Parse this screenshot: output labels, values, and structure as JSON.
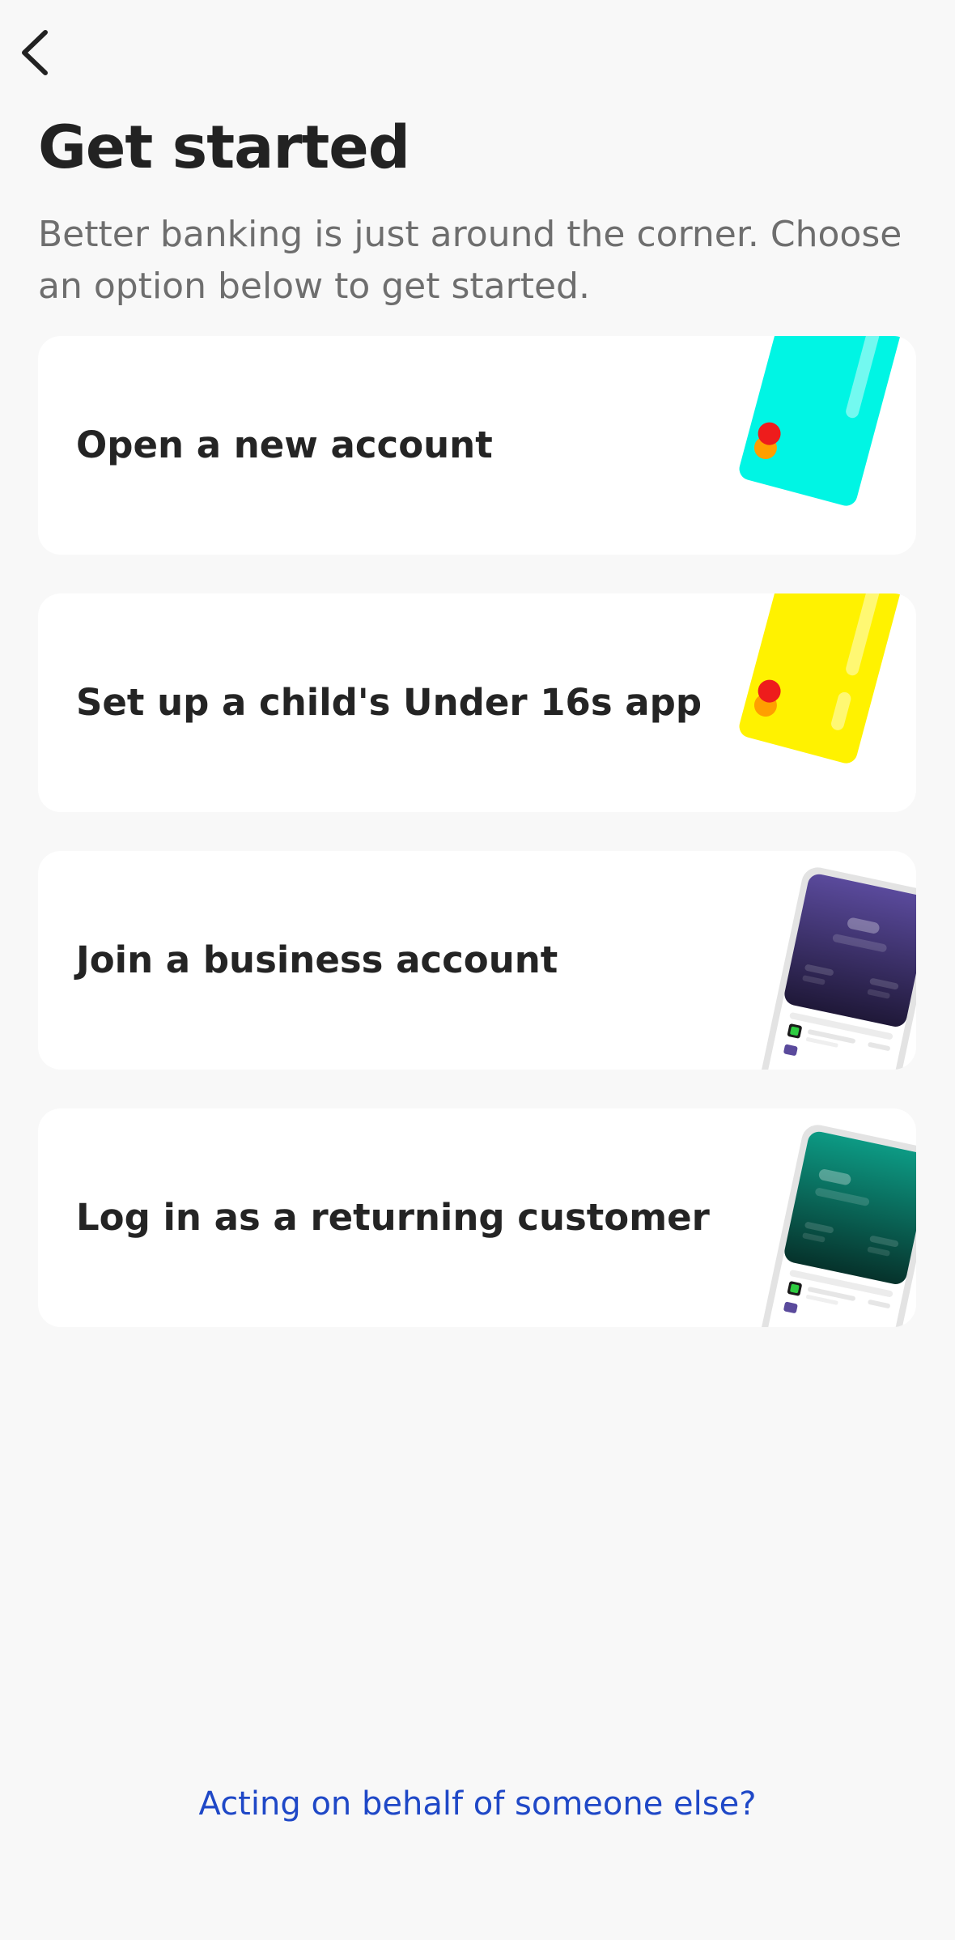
{
  "header": {
    "back_icon": "chevron-left-icon"
  },
  "intro": {
    "title": "Get started",
    "subtitle": "Better banking is just around the corner. Choose an option below to get started."
  },
  "options": [
    {
      "label": "Open a new account",
      "art": "teal-debit-card-illustration",
      "accent": "#00f5e4"
    },
    {
      "label": "Set up a child's Under 16s app",
      "art": "yellow-debit-card-illustration",
      "accent": "#fff200"
    },
    {
      "label": "Join a business account",
      "art": "purple-phone-app-illustration",
      "accent": "#4d3f8a"
    },
    {
      "label": "Log in as a returning customer",
      "art": "green-phone-app-illustration",
      "accent": "#0b8f7a"
    }
  ],
  "footer": {
    "link": "Acting on behalf of someone else?",
    "link_color": "#1f48c7"
  }
}
